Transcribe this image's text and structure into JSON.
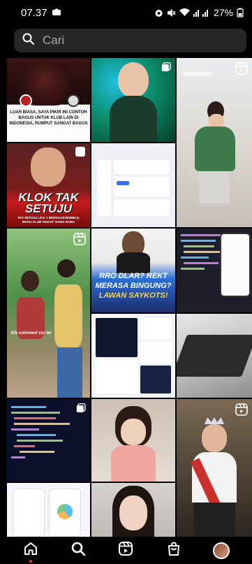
{
  "status_bar": {
    "time": "07.37",
    "battery": "27%"
  },
  "search": {
    "placeholder": "Cari"
  },
  "tiles": {
    "t1": {
      "caption": "LUAR BIASA, SAYA PIKIR INI CONTOH BAGUS UNTUK KLUB LAIN DI INDONESIA, RUMPUT SANGAT BAGUS"
    },
    "t4": {
      "headline": "KLOK TAK SETUJU",
      "sub": "TAK SETUJU LIGA 1 BERSALIN BUBBLE, MAHU KLUB 'DEKAT' SAMA-SAMA"
    },
    "t7": {
      "headline1": "RRO DLAR? REKT",
      "headline2": "MERASA BINGUNG?",
      "headline3": "LAWAN SAYKOTS!"
    },
    "t6": {
      "caption": "Kis comment cor be"
    }
  },
  "icons": {
    "reel": "reel-icon",
    "multi": "multi-post-icon"
  },
  "nav": {
    "home": "home-icon",
    "search": "search-icon",
    "reels": "reels-icon",
    "shop": "shop-icon",
    "profile": "avatar"
  }
}
